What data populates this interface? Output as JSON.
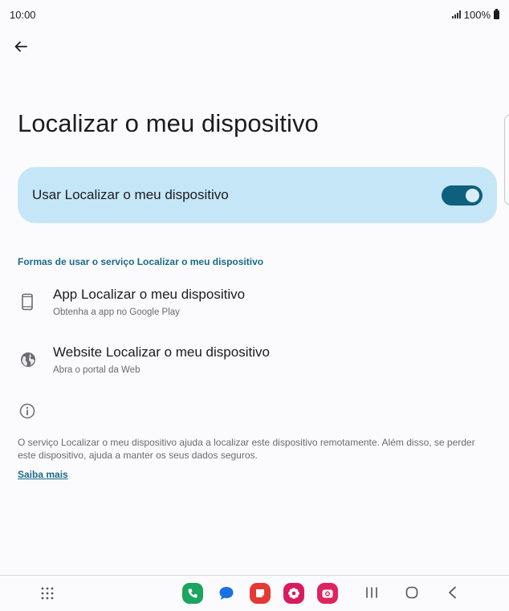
{
  "status_bar": {
    "time": "10:00",
    "battery": "100%"
  },
  "page": {
    "title": "Localizar o meu dispositivo"
  },
  "toggle": {
    "label": "Usar Localizar o meu dispositivo",
    "state": "on"
  },
  "section": {
    "header": "Formas de usar o serviço Localizar o meu dispositivo"
  },
  "items": [
    {
      "title": "App Localizar o meu dispositivo",
      "subtitle": "Obtenha a app no Google Play",
      "icon": "phone-icon"
    },
    {
      "title": "Website Localizar o meu dispositivo",
      "subtitle": "Abra o portal da Web",
      "icon": "globe-icon"
    }
  ],
  "info": {
    "icon": "info-icon",
    "description": "O serviço Localizar o meu dispositivo ajuda a localizar este dispositivo remotamente. Além disso, se perder este dispositivo, ajuda a manter os seus dados seguros.",
    "link": "Saiba mais"
  },
  "colors": {
    "accent": "#1a6a86",
    "card": "#c5e6f7",
    "switch_track": "#0f5f7e",
    "phone_app": "#1ba560",
    "messages_app": "#1b6fe0",
    "notes_app": "#e53935",
    "flower_app": "#d81b60",
    "camera_app": "#e0245e"
  }
}
